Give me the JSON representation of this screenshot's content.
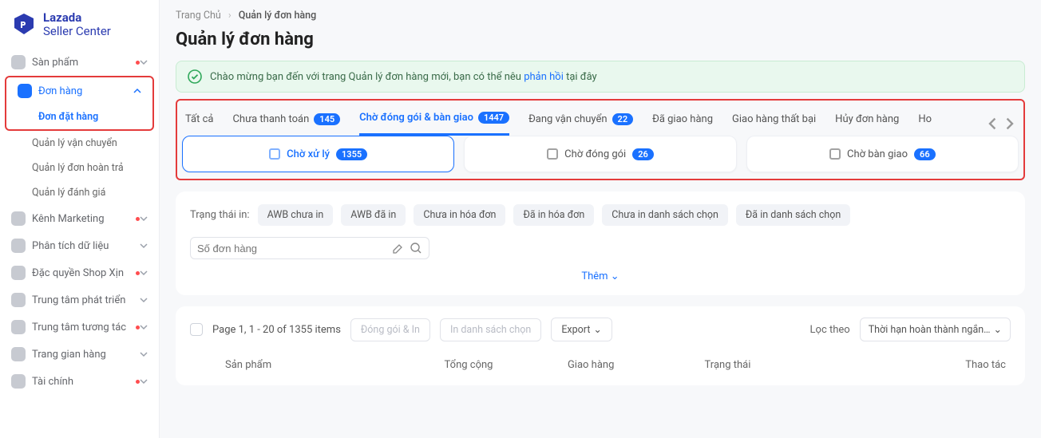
{
  "logo": {
    "title": "Lazada",
    "subtitle": "Seller Center"
  },
  "sidebar": {
    "items": [
      {
        "label": "Sàn phẩm",
        "dot": true
      },
      {
        "label": "Đơn hàng",
        "expanded": true,
        "active": true,
        "children": [
          {
            "label": "Đơn đặt hàng",
            "active": true
          },
          {
            "label": "Quản lý vận chuyển"
          },
          {
            "label": "Quản lý đơn hoàn trả"
          },
          {
            "label": "Quản lý đánh giá"
          }
        ]
      },
      {
        "label": "Kênh Marketing",
        "dot": true
      },
      {
        "label": "Phân tích dữ liệu"
      },
      {
        "label": "Đặc quyền Shop Xịn",
        "dot": true
      },
      {
        "label": "Trung tâm phát triển"
      },
      {
        "label": "Trung tâm tương tác",
        "dot": true
      },
      {
        "label": "Trang gian hàng"
      },
      {
        "label": "Tài chính",
        "dot": true
      }
    ]
  },
  "breadcrumb": {
    "home": "Trang Chủ",
    "current": "Quản lý đơn hàng"
  },
  "page_title": "Quản lý đơn hàng",
  "alert": {
    "prefix": "Chào mừng bạn đến với trang Quản lý đơn hàng mới, bạn có thể nêu ",
    "link": "phản hồi",
    "suffix": " tại đây"
  },
  "tabs": [
    {
      "label": "Tất cả"
    },
    {
      "label": "Chưa thanh toán",
      "badge": "145"
    },
    {
      "label": "Chờ đóng gói & bàn giao",
      "badge": "1447",
      "active": true
    },
    {
      "label": "Đang vận chuyển",
      "badge": "22"
    },
    {
      "label": "Đã giao hàng"
    },
    {
      "label": "Giao hàng thất bại"
    },
    {
      "label": "Hủy đơn hàng"
    },
    {
      "label": "Ho"
    }
  ],
  "subtabs": [
    {
      "label": "Chờ xử lý",
      "badge": "1355",
      "active": true
    },
    {
      "label": "Chờ đóng gói",
      "badge": "26"
    },
    {
      "label": "Chờ bàn giao",
      "badge": "66"
    }
  ],
  "filters": {
    "label": "Trạng thái in:",
    "chips": [
      "AWB chưa in",
      "AWB đã in",
      "Chưa in hóa đơn",
      "Đã in hóa đơn",
      "Chưa in danh sách chọn",
      "Đã in danh sách chọn"
    ]
  },
  "search": {
    "placeholder": "Số đơn hàng"
  },
  "more_label": "Thêm",
  "toolbar": {
    "page_info": "Page 1, 1 - 20 of 1355 items",
    "btn_pack": "Đóng gói & In",
    "btn_pick": "In danh sách chọn",
    "btn_export": "Export",
    "sort_label": "Lọc theo",
    "sort_value": "Thời hạn hoàn thành ngắn…"
  },
  "table": {
    "columns": [
      "Sản phẩm",
      "Tổng cộng",
      "Giao hàng",
      "Trạng thái",
      "Thao tác"
    ]
  }
}
